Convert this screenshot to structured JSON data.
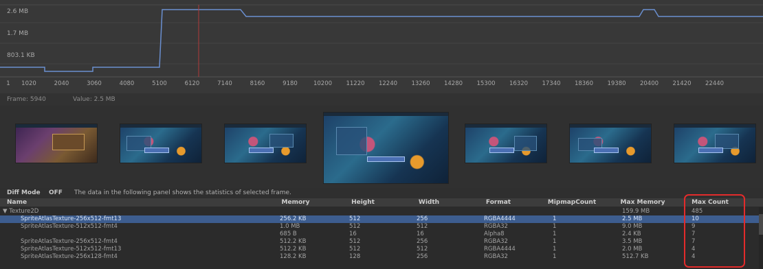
{
  "graph": {
    "y_labels": [
      "2.6 MB",
      "1.7 MB",
      "803.1 KB"
    ],
    "x_labels": [
      "1",
      "1020",
      "2040",
      "3060",
      "4080",
      "5100",
      "6120",
      "7140",
      "8160",
      "9180",
      "10200",
      "11220",
      "12240",
      "13260",
      "14280",
      "15300",
      "16320",
      "17340",
      "18360",
      "19380",
      "20400",
      "21420",
      "22440"
    ],
    "line_color": "#6a8fd0",
    "cursor_color": "#b03a3a",
    "cursor_frame": 5940
  },
  "info": {
    "frame": "Frame: 5940",
    "value": "Value: 2.5 MB"
  },
  "screenshots": [
    {
      "name": "shot-1"
    },
    {
      "name": "shot-2"
    },
    {
      "name": "shot-3"
    },
    {
      "name": "shot-4"
    },
    {
      "name": "shot-5"
    },
    {
      "name": "shot-6"
    },
    {
      "name": "shot-7"
    }
  ],
  "diff": {
    "label": "Diff Mode",
    "state": "OFF",
    "note": "The data in the following panel shows the statistics of selected frame."
  },
  "table": {
    "headers": {
      "name": "Name",
      "memory": "Memory",
      "height": "Height",
      "width": "Width",
      "format": "Format",
      "mipmap": "MipmapCount",
      "max_memory": "Max Memory",
      "max_count": "Max Count"
    },
    "group": {
      "name": "▼ Texture2D",
      "max_memory": "159.9 MB",
      "max_count": "485"
    },
    "rows": [
      {
        "name": "SpriteAtlasTexture-256x512-fmt13",
        "memory": "256.2 KB",
        "height": "512",
        "width": "256",
        "format": "RGBA4444",
        "mipmap": "1",
        "max_memory": "2.5 MB",
        "max_count": "10",
        "selected": true
      },
      {
        "name": "SpriteAtlasTexture-512x512-fmt4",
        "memory": "1.0 MB",
        "height": "512",
        "width": "512",
        "format": "RGBA32",
        "mipmap": "1",
        "max_memory": "9.0 MB",
        "max_count": "9"
      },
      {
        "name": "",
        "memory": "685 B",
        "height": "16",
        "width": "16",
        "format": "Alpha8",
        "mipmap": "1",
        "max_memory": "2.4 KB",
        "max_count": "7"
      },
      {
        "name": "SpriteAtlasTexture-256x512-fmt4",
        "memory": "512.2 KB",
        "height": "512",
        "width": "256",
        "format": "RGBA32",
        "mipmap": "1",
        "max_memory": "3.5 MB",
        "max_count": "7"
      },
      {
        "name": "SpriteAtlasTexture-512x512-fmt13",
        "memory": "512.2 KB",
        "height": "512",
        "width": "512",
        "format": "RGBA4444",
        "mipmap": "1",
        "max_memory": "2.0 MB",
        "max_count": "4"
      },
      {
        "name": "SpriteAtlasTexture-256x128-fmt4",
        "memory": "128.2 KB",
        "height": "128",
        "width": "256",
        "format": "RGBA32",
        "mipmap": "1",
        "max_memory": "512.7 KB",
        "max_count": "4"
      }
    ]
  },
  "highlight_color": "#e32b2b"
}
